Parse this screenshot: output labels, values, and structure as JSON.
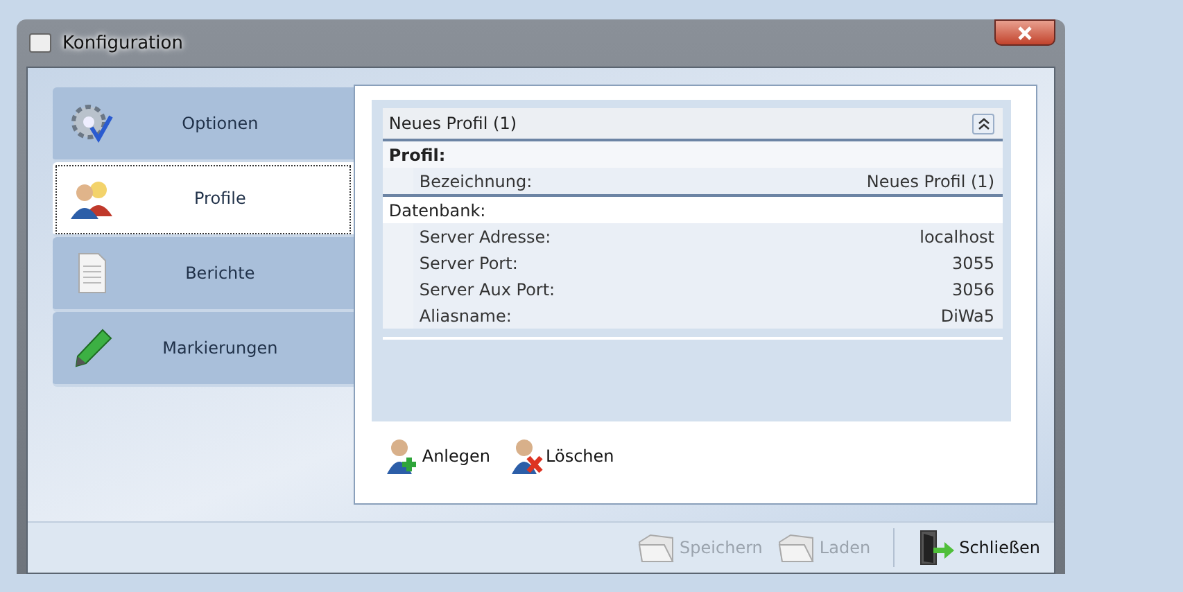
{
  "window": {
    "title": "Konfiguration"
  },
  "tabs": [
    {
      "label": "Optionen",
      "kind": "gear",
      "selected": false
    },
    {
      "label": "Profile",
      "kind": "users",
      "selected": true
    },
    {
      "label": "Berichte",
      "kind": "document",
      "selected": false
    },
    {
      "label": "Markierungen",
      "kind": "marker",
      "selected": false
    }
  ],
  "profile_panel": {
    "title": "Neues Profil (1)",
    "expanded": true,
    "sections": [
      {
        "heading": "Profil:",
        "bold": true,
        "fields": [
          {
            "label": "Bezeichnung:",
            "value": "Neues Profil (1)"
          }
        ]
      },
      {
        "heading": "Datenbank:",
        "bold": false,
        "fields": [
          {
            "label": "Server Adresse:",
            "value": "localhost"
          },
          {
            "label": "Server Port:",
            "value": "3055"
          },
          {
            "label": "Server Aux Port:",
            "value": "3056"
          },
          {
            "label": "Aliasname:",
            "value": "DiWa5"
          }
        ]
      }
    ]
  },
  "profile_actions": [
    {
      "label": "Anlegen",
      "kind": "add"
    },
    {
      "label": "Löschen",
      "kind": "delete"
    }
  ],
  "footer_buttons": [
    {
      "label": "Speichern",
      "kind": "folder",
      "disabled": true
    },
    {
      "label": "Laden",
      "kind": "folder",
      "disabled": true
    },
    {
      "label": "Schließen",
      "kind": "exit",
      "disabled": false
    }
  ]
}
